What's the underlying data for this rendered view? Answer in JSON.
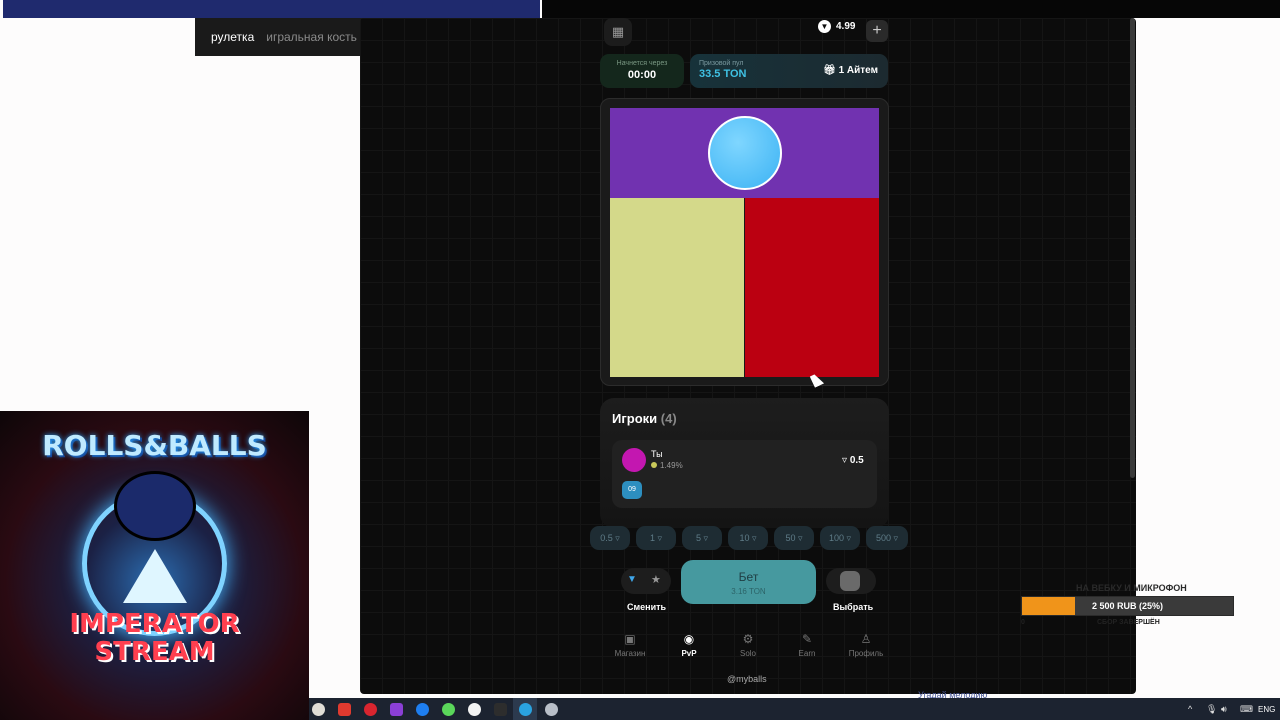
{
  "browser": {
    "tabs": [
      "рулетка",
      "игральная кость"
    ]
  },
  "header": {
    "balance": "4.99",
    "plus": "+"
  },
  "round": {
    "starts_label": "Начнется через",
    "starts_value": "00:00",
    "pool_label": "Призовой пул",
    "pool_value": "33.5 TON",
    "items": "1 Айтем"
  },
  "board": {
    "segments": [
      {
        "color": "#7132b0"
      },
      {
        "color": "#d4d98a"
      },
      {
        "color": "#bb0011"
      }
    ],
    "ball_color": "#3bb2f3"
  },
  "players": {
    "title": "Игроки",
    "count": "(4)",
    "rows": [
      {
        "name": "Ты",
        "percent": "1.49%",
        "bet": "0.5",
        "badge": "09",
        "avatar_color": "#c317b0"
      }
    ]
  },
  "bet_chips": [
    "0.5",
    "1",
    "5",
    "10",
    "50",
    "100",
    "500"
  ],
  "actions": {
    "swap_label": "Сменить",
    "bet_label": "Бет",
    "bet_sub": "3.16 TON",
    "pick_label": "Выбрать"
  },
  "nav": [
    {
      "label": "Магазин",
      "icon": "shop-icon"
    },
    {
      "label": "PvP",
      "icon": "pvp-icon"
    },
    {
      "label": "Solo",
      "icon": "gear-icon"
    },
    {
      "label": "Earn",
      "icon": "earn-icon"
    },
    {
      "label": "Профиль",
      "icon": "profile-icon"
    }
  ],
  "handle": "@myballs",
  "stream_art": {
    "top_text": "ROLLS&BALLS",
    "bottom_line1": "IMPERATOR",
    "bottom_line2": "STREAM"
  },
  "donation": {
    "title": "НА ВЕБКУ И МИКРОФОН",
    "text": "2 500 RUB (25%)",
    "progress": 0.25,
    "min": "0",
    "status": "СБОР ЗАВЕРШЁН"
  },
  "taskbar": {
    "lang": "ENG",
    "peek_text": "Угадай мелодию"
  }
}
